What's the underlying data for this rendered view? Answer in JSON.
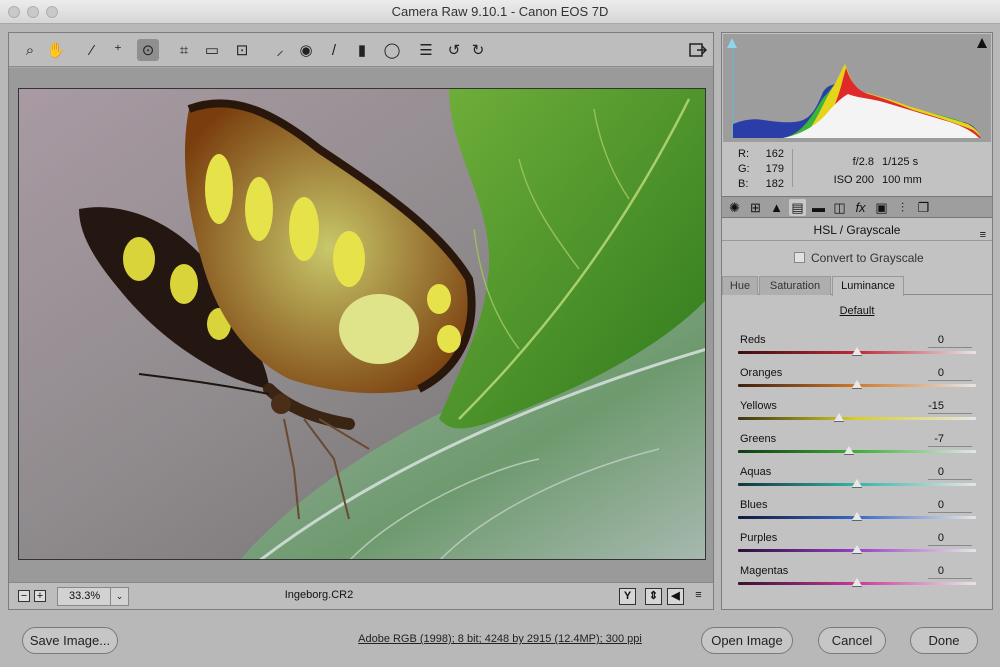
{
  "window": {
    "title": "Camera Raw 9.10.1  -  Canon EOS 7D"
  },
  "toolbar": {
    "tools": [
      {
        "name": "zoom-tool",
        "icon": "magnifier-icon",
        "glyph": "⌕"
      },
      {
        "name": "hand-tool",
        "icon": "hand-icon",
        "glyph": "✋"
      },
      {
        "name": "white-balance-tool",
        "icon": "eyedropper-icon",
        "glyph": "⁄"
      },
      {
        "name": "color-sampler-tool",
        "icon": "color-sampler-icon",
        "glyph": "⁺"
      },
      {
        "name": "targeted-adjustment-tool",
        "icon": "target-adjust-icon",
        "glyph": "⊙"
      },
      {
        "name": "crop-tool",
        "icon": "crop-icon",
        "glyph": "⌗"
      },
      {
        "name": "straighten-tool",
        "icon": "level-icon",
        "glyph": "▭"
      },
      {
        "name": "transform-tool",
        "icon": "transform-icon",
        "glyph": "⊡"
      },
      {
        "name": "spot-removal-tool",
        "icon": "spot-brush-icon",
        "glyph": "⸝"
      },
      {
        "name": "red-eye-tool",
        "icon": "red-eye-icon",
        "glyph": "◉"
      },
      {
        "name": "adjustment-brush-tool",
        "icon": "brush-icon",
        "glyph": "/"
      },
      {
        "name": "graduated-filter-tool",
        "icon": "graduated-filter-icon",
        "glyph": "▮"
      },
      {
        "name": "radial-filter-tool",
        "icon": "radial-filter-icon",
        "glyph": "◯"
      },
      {
        "name": "preferences-button",
        "icon": "list-icon",
        "glyph": "☰"
      },
      {
        "name": "rotate-left-button",
        "icon": "rotate-ccw-icon",
        "glyph": "↺"
      },
      {
        "name": "rotate-right-button",
        "icon": "rotate-cw-icon",
        "glyph": "↻"
      }
    ],
    "fullscreen_icon": "export-icon"
  },
  "statusbar": {
    "zoom_value": "33.3%",
    "filename": "Ingeborg.CR2",
    "minus_label": "−",
    "plus_label": "+",
    "dropdown_glyph": "⌄",
    "view_buttons": [
      "Y",
      "⇕",
      "◀",
      "≡"
    ]
  },
  "info": {
    "r_label": "R:",
    "r_value": "162",
    "g_label": "G:",
    "g_value": "179",
    "b_label": "B:",
    "b_value": "182",
    "aperture": "f/2.8",
    "shutter": "1/125 s",
    "iso": "ISO 200",
    "focal_length": "100 mm"
  },
  "panel": {
    "title": "HSL / Grayscale",
    "menu_glyph": "≡",
    "convert_label": "Convert to Grayscale",
    "tabs": [
      {
        "name": "tab-basic",
        "glyph": "✺",
        "icon": "aperture-icon"
      },
      {
        "name": "tab-tone-curve",
        "glyph": "⊞",
        "icon": "curve-grid-icon"
      },
      {
        "name": "tab-detail",
        "glyph": "▲",
        "icon": "mountains-icon"
      },
      {
        "name": "tab-hsl",
        "glyph": "▤",
        "icon": "hsl-icon"
      },
      {
        "name": "tab-split-toning",
        "glyph": "▬",
        "icon": "split-toning-icon"
      },
      {
        "name": "tab-lens-corrections",
        "glyph": "◫",
        "icon": "lens-icon"
      },
      {
        "name": "tab-effects",
        "glyph": "fx",
        "icon": "fx-icon"
      },
      {
        "name": "tab-camera-calibration",
        "glyph": "▣",
        "icon": "camera-icon"
      },
      {
        "name": "tab-presets",
        "glyph": "⫶",
        "icon": "sliders-icon"
      },
      {
        "name": "tab-snapshots",
        "glyph": "❐",
        "icon": "snapshots-icon"
      }
    ],
    "subtabs": [
      "Hue",
      "Saturation",
      "Luminance"
    ],
    "active_subtab": "Luminance",
    "default_label": "Default",
    "sliders": [
      {
        "label": "Reds",
        "value": "0",
        "level": 0
      },
      {
        "label": "Oranges",
        "value": "0",
        "level": 0
      },
      {
        "label": "Yellows",
        "value": "-15",
        "level": -15
      },
      {
        "label": "Greens",
        "value": "-7",
        "level": -7
      },
      {
        "label": "Aquas",
        "value": "0",
        "level": 0
      },
      {
        "label": "Blues",
        "value": "0",
        "level": 0
      },
      {
        "label": "Purples",
        "value": "0",
        "level": 0
      },
      {
        "label": "Magentas",
        "value": "0",
        "level": 0
      }
    ],
    "slider_colors": [
      [
        "#3a1010",
        "#c0283a"
      ],
      [
        "#3d2010",
        "#d07a2a"
      ],
      [
        "#3a3510",
        "#d8cf2a"
      ],
      [
        "#103a14",
        "#3fae3a"
      ],
      [
        "#10353a",
        "#36b5aa"
      ],
      [
        "#101a3a",
        "#3a68c8"
      ],
      [
        "#2a103a",
        "#9a40c8"
      ],
      [
        "#3a1030",
        "#c83a9a"
      ]
    ]
  },
  "footer": {
    "save_label": "Save Image...",
    "workflow_text": "Adobe RGB (1998); 8 bit; 4248 by 2915 (12.4MP); 300 ppi",
    "open_label": "Open Image",
    "cancel_label": "Cancel",
    "done_label": "Done"
  }
}
